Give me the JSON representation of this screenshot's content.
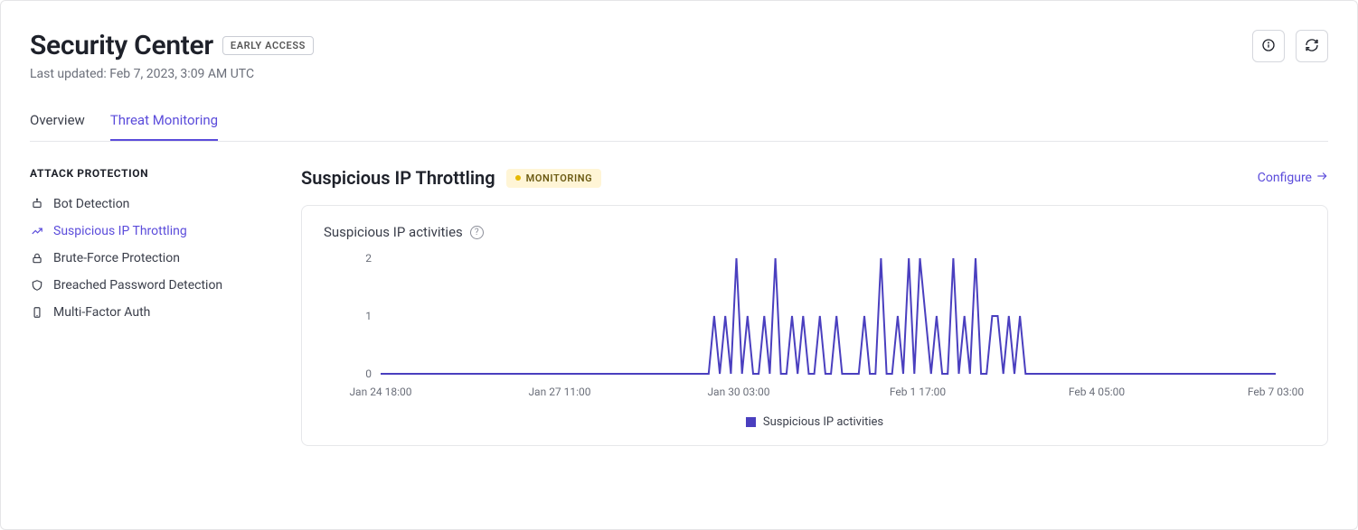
{
  "header": {
    "title": "Security Center",
    "badge": "EARLY ACCESS",
    "subtitle": "Last updated: Feb 7, 2023, 3:09 AM UTC"
  },
  "tabs": [
    {
      "label": "Overview",
      "active": false
    },
    {
      "label": "Threat Monitoring",
      "active": true
    }
  ],
  "sidebar": {
    "heading": "ATTACK PROTECTION",
    "items": [
      {
        "label": "Bot Detection",
        "icon": "bot-icon",
        "active": false
      },
      {
        "label": "Suspicious IP Throttling",
        "icon": "trend-icon",
        "active": true
      },
      {
        "label": "Brute-Force Protection",
        "icon": "lock-icon",
        "active": false
      },
      {
        "label": "Breached Password Detection",
        "icon": "shield-icon",
        "active": false
      },
      {
        "label": "Multi-Factor Auth",
        "icon": "device-icon",
        "active": false
      }
    ]
  },
  "main": {
    "title": "Suspicious IP Throttling",
    "status_badge": "MONITORING",
    "configure_label": "Configure",
    "card_title": "Suspicious IP activities",
    "legend_label": "Suspicious IP activities"
  },
  "chart_data": {
    "type": "line",
    "title": "Suspicious IP activities",
    "xlabel": "",
    "ylabel": "",
    "ylim": [
      0,
      2
    ],
    "y_ticks": [
      0,
      1,
      2
    ],
    "x_ticks": [
      "Jan 24 18:00",
      "Jan 27 11:00",
      "Jan 30 03:00",
      "Feb 1 17:00",
      "Feb 4 05:00",
      "Feb 7 03:00"
    ],
    "series": [
      {
        "name": "Suspicious IP activities",
        "color": "#4a3fbf",
        "values": [
          0,
          0,
          0,
          0,
          0,
          0,
          0,
          0,
          0,
          0,
          0,
          0,
          0,
          0,
          0,
          0,
          0,
          0,
          0,
          0,
          0,
          0,
          0,
          0,
          0,
          0,
          0,
          0,
          0,
          0,
          0,
          0,
          0,
          0,
          0,
          0,
          0,
          0,
          0,
          0,
          0,
          0,
          0,
          0,
          0,
          0,
          0,
          0,
          0,
          0,
          0,
          0,
          0,
          0,
          0,
          0,
          0,
          0,
          0,
          0,
          1,
          0,
          1,
          0,
          2,
          0,
          1,
          0,
          0,
          1,
          0,
          2,
          0,
          0,
          1,
          0,
          1,
          0,
          0,
          1,
          0,
          0,
          1,
          0,
          0,
          0,
          0,
          1,
          0,
          0,
          2,
          0,
          0,
          1,
          0,
          2,
          0,
          2,
          1,
          0,
          1,
          0,
          0,
          2,
          0,
          1,
          0,
          2,
          0,
          0,
          1,
          1,
          0,
          1,
          0,
          1,
          0,
          0,
          0,
          0,
          0,
          0,
          0,
          0,
          0,
          0,
          0,
          0,
          0,
          0,
          0,
          0,
          0,
          0,
          0,
          0,
          0,
          0,
          0,
          0,
          0,
          0,
          0,
          0,
          0,
          0,
          0,
          0,
          0,
          0,
          0,
          0,
          0,
          0,
          0,
          0,
          0,
          0,
          0,
          0,
          0,
          0
        ]
      }
    ]
  }
}
